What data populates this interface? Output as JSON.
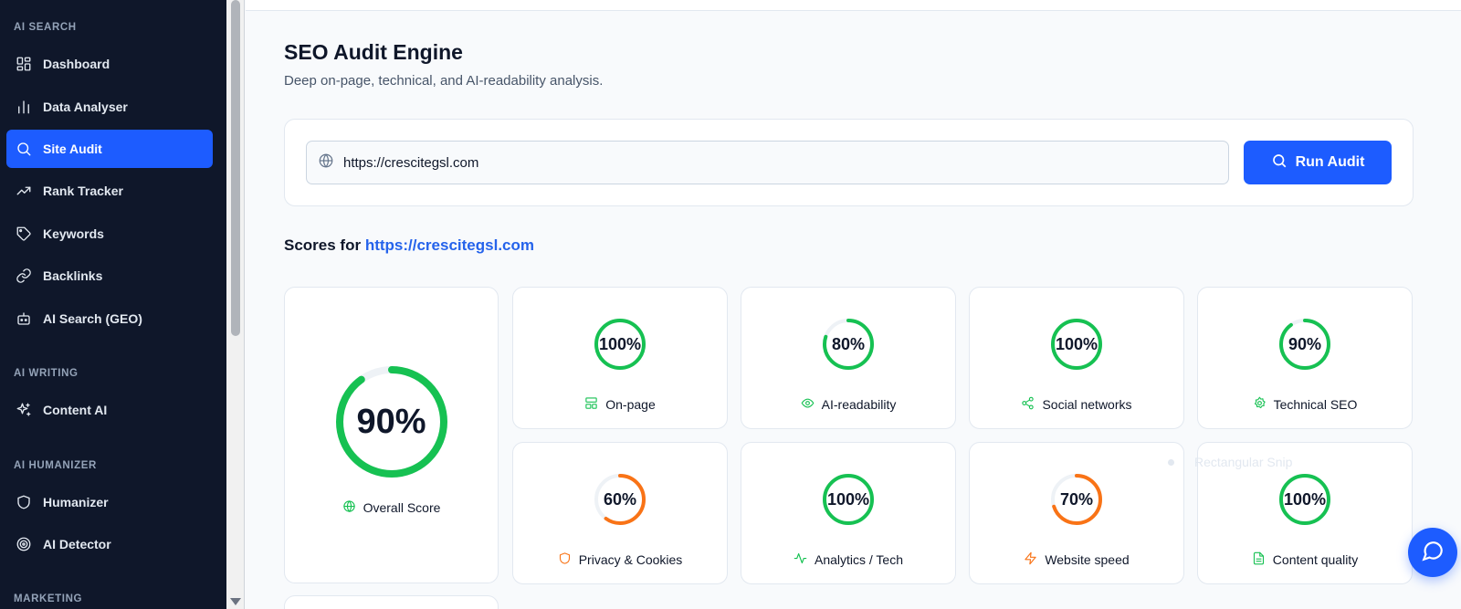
{
  "sidebar": {
    "sections": [
      {
        "title": "AI SEARCH"
      },
      {
        "title": "AI WRITING"
      },
      {
        "title": "AI HUMANIZER"
      },
      {
        "title": "MARKETING"
      }
    ],
    "items": [
      {
        "label": "Dashboard",
        "icon": "dashboard-icon"
      },
      {
        "label": "Data Analyser",
        "icon": "bar-chart-icon"
      },
      {
        "label": "Site Audit",
        "icon": "search-icon",
        "active": true
      },
      {
        "label": "Rank Tracker",
        "icon": "trending-up-icon"
      },
      {
        "label": "Keywords",
        "icon": "tag-icon"
      },
      {
        "label": "Backlinks",
        "icon": "link-icon"
      },
      {
        "label": "AI Search (GEO)",
        "icon": "bot-icon"
      },
      {
        "label": "Content AI",
        "icon": "sparkles-icon"
      },
      {
        "label": "Humanizer",
        "icon": "shield-icon"
      },
      {
        "label": "AI Detector",
        "icon": "target-icon"
      }
    ]
  },
  "header": {
    "title": "SEO Audit Engine",
    "subtitle": "Deep on-page, technical, and AI-readability analysis."
  },
  "audit": {
    "url_value": "https://crescitegsl.com",
    "run_label": "Run Audit"
  },
  "scores": {
    "heading_prefix": "Scores for",
    "heading_url": "https://crescitegsl.com",
    "overall": {
      "value": "90%",
      "percent": 90,
      "label": "Overall Score",
      "color": "#16c152"
    },
    "cards": [
      {
        "value": "100%",
        "percent": 100,
        "label": "On-page",
        "icon": "layout-icon",
        "color": "#16c152"
      },
      {
        "value": "80%",
        "percent": 80,
        "label": "AI-readability",
        "icon": "eye-icon",
        "color": "#16c152"
      },
      {
        "value": "100%",
        "percent": 100,
        "label": "Social networks",
        "icon": "share-icon",
        "color": "#16c152"
      },
      {
        "value": "90%",
        "percent": 90,
        "label": "Technical SEO",
        "icon": "gear-icon",
        "color": "#16c152"
      },
      {
        "value": "60%",
        "percent": 60,
        "label": "Privacy & Cookies",
        "icon": "shield-icon",
        "color": "#f97316"
      },
      {
        "value": "100%",
        "percent": 100,
        "label": "Analytics / Tech",
        "icon": "activity-icon",
        "color": "#16c152"
      },
      {
        "value": "70%",
        "percent": 70,
        "label": "Website speed",
        "icon": "zap-icon",
        "color": "#f97316"
      },
      {
        "value": "100%",
        "percent": 100,
        "label": "Content quality",
        "icon": "file-icon",
        "color": "#16c152"
      }
    ]
  },
  "overlay": {
    "snip_label": "Rectangular Snip"
  },
  "chat": {
    "icon": "chat-icon"
  }
}
